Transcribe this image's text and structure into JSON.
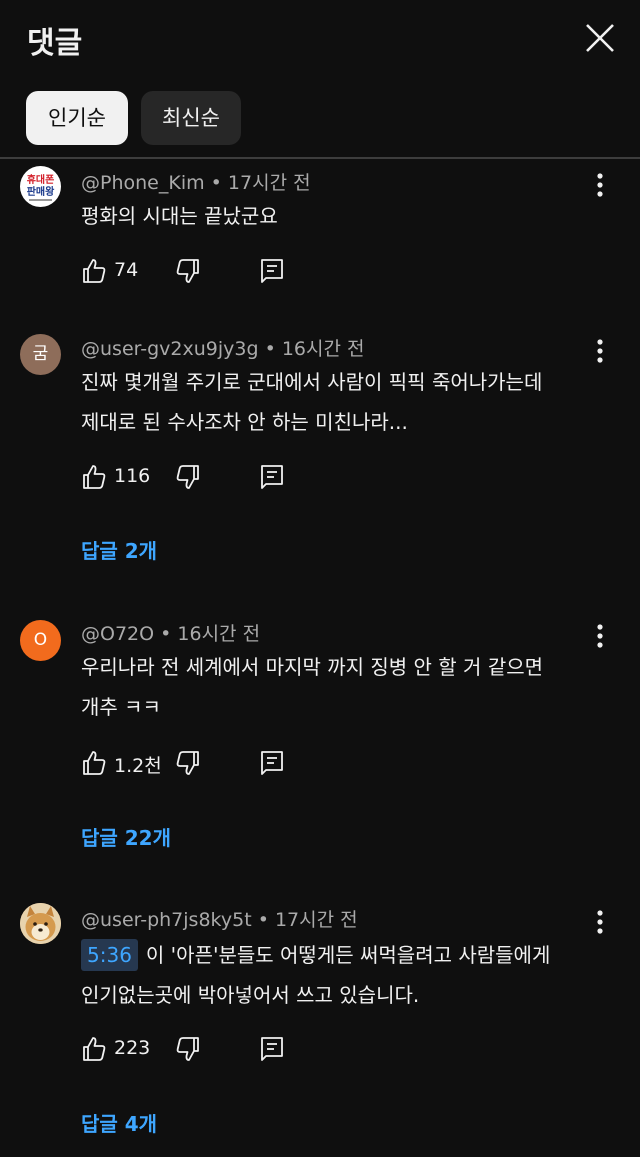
{
  "header": {
    "title": "댓글"
  },
  "sort_chips": [
    {
      "label": "인기순",
      "active": true
    },
    {
      "label": "최신순",
      "active": false
    }
  ],
  "comments": [
    {
      "author": "@Phone_Kim",
      "time": "17시간 전",
      "avatar_text": "휴대폰 판매왕",
      "lines": [
        "평화의 시대는 끝났군요"
      ],
      "likes": "74",
      "replies": ""
    },
    {
      "author": "@user-gv2xu9jy3g",
      "time": "16시간 전",
      "avatar_text": "굼",
      "lines": [
        "진짜 몇개월 주기로 군대에서 사람이 픽픽 죽어나가는데",
        "제대로 된 수사조차 안 하는 미친나라..."
      ],
      "likes": "116",
      "replies": "답글 2개"
    },
    {
      "author": "@O72O",
      "time": "16시간 전",
      "avatar_text": "O",
      "lines": [
        "우리나라 전 세계에서 마지막 까지 징병 안 할 거 같으면",
        "개추 ㅋㅋ"
      ],
      "likes": "1.2천",
      "replies": "답글 22개"
    },
    {
      "author": "@user-ph7js8ky5t",
      "time": "17시간 전",
      "avatar_text": "",
      "timestamp": "5:36",
      "lines": [
        "이 '아픈'분들도 어떻게든 써먹을려고 사람들에게",
        "인기없는곳에 박아넣어서 쓰고 있습니다."
      ],
      "likes": "223",
      "replies": "답글 4개"
    }
  ],
  "colors": {
    "background": "#0f0f0f",
    "link": "#3ea6ff",
    "meta": "#aaaaaa",
    "chip_active": "#f1f1f1",
    "chip_inactive": "#272727"
  },
  "icons": [
    "close-icon",
    "like-icon",
    "dislike-icon",
    "reply-icon",
    "more-icon"
  ]
}
